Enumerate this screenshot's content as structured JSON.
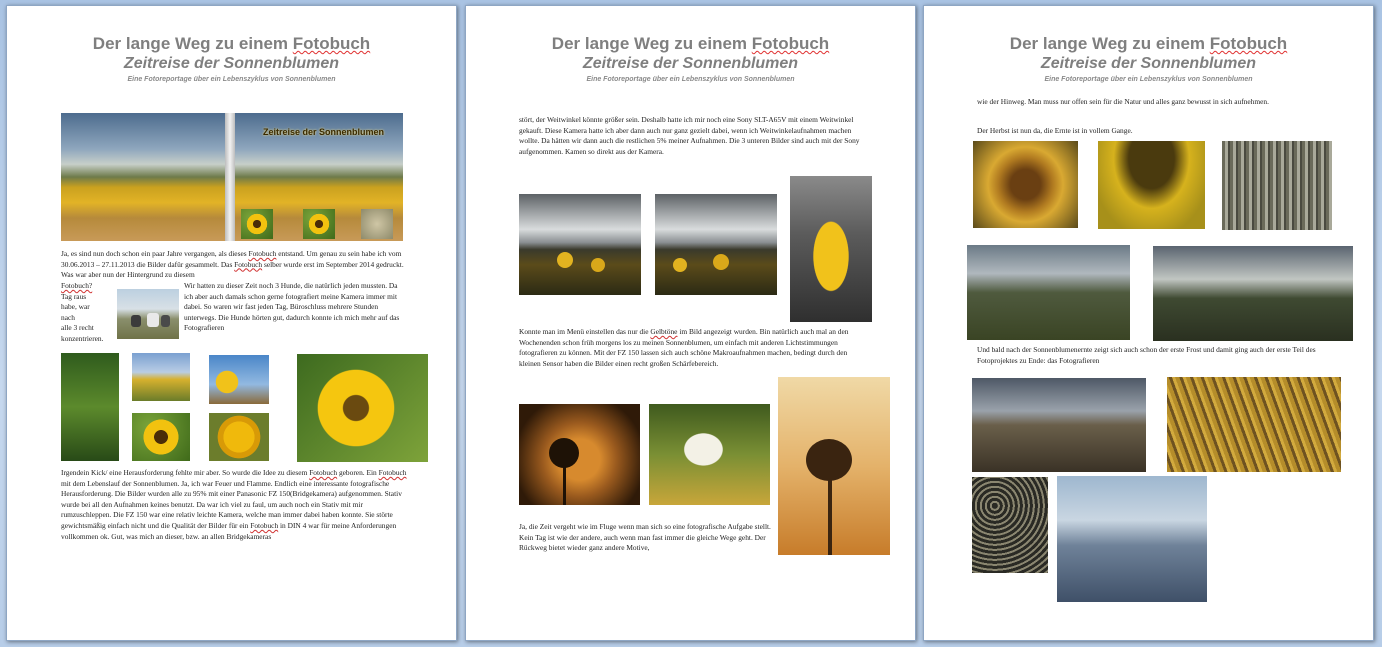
{
  "header": {
    "title_pre": "Der lange Weg zu einem ",
    "title_word": "Fotobuch",
    "subtitle": "Zeitreise der Sonnenblumen",
    "tagline": "Eine Fotoreportage über ein Lebenszyklus von Sonnenblumen"
  },
  "page1": {
    "banner_caption": "Zeitreise der Sonnenblumen",
    "para1": {
      "a": "Ja, es sind nun doch schon ein paar Jahre vergangen, als dieses ",
      "b": "Fotobuch",
      "c": " entstand. Um genau zu sein habe ich vom 30.06.2013 – 27.11.2013 die Bilder dafür gesammelt. Das ",
      "d": "Fotobuch",
      "e": " selber wurde erst im September 2014 gedruckt. Was war aber nun der Hintergrund zu diesem"
    },
    "left_col": {
      "w": "Fotobuch?",
      "l1": "Tag raus",
      "l2": "habe, war",
      "l3": "nach",
      "l4": "alle 3 recht",
      "l5": "konzentrieren."
    },
    "right_col": "Wir hatten zu dieser Zeit noch 3 Hunde, die natürlich jeden mussten. Da ich aber auch damals schon gerne fotografiert meine Kamera immer mit dabei. So waren wir fast jeden Tag, Büroschluss mehrere Stunden unterwegs. Die Hunde hörten gut, dadurch konnte ich mich mehr auf das Fotografieren",
    "para2": {
      "a": "Irgendein Kick/ eine Herausforderung fehlte mir aber. So wurde die Idee zu diesem ",
      "b": "Fotobuch",
      "c": " geboren. Ein ",
      "d": "Fotobuch",
      "e": " mit dem Lebenslauf der Sonnenblumen. Ja, ich war Feuer und Flamme. Endlich eine interessante fotografische Herausforderung. Die Bilder wurden alle zu 95% mit einer Panasonic FZ 150(Bridgekamera) aufgenommen. Stativ wurde bei all den Aufnahmen keines benutzt. Da war ich viel zu faul, um auch noch ein Stativ mit mir rumzuschleppen. Die FZ 150 war eine relativ leichte Kamera, welche man immer dabei haben konnte. Sie störte gewichtsmäßig einfach nicht und die Qualität der Bilder für ein ",
      "f": "Fotobuch",
      "g": " in DIN 4 war für meine Anforderungen vollkommen ok. Gut, was mich an dieser, bzw. an allen Bridgekameras"
    }
  },
  "page2": {
    "para1": "stört, der Weitwinkel könnte größer sein. Deshalb hatte ich mir noch eine Sony SLT-A65V mit einem Weitwinkel gekauft. Diese Kamera hatte ich aber dann auch nur ganz gezielt dabei, wenn ich Weitwinkelaufnahmen machen wollte. Da hätten wir dann auch die restlichen 5% meiner Aufnahmen. Die 3 unteren Bilder sind auch mit der Sony aufgenommen. Kamen so direkt aus der Kamera.",
    "para2": {
      "a": "Konnte man im Menü einstellen das nur die ",
      "b": "Gelbtöne",
      "c": " im Bild angezeigt wurden. Bin natürlich auch mal an den Wochenenden schon früh morgens los zu meinen Sonnenblumen, um einfach mit anderen Lichtstimmungen fotografieren zu können. Mit der FZ 150 lassen sich auch schöne Makroaufnahmen machen, bedingt durch den kleinen Sensor haben die Bilder einen recht großen Schärfebereich."
    },
    "para3": "Ja, die Zeit vergeht wie im Fluge wenn   man sich so eine fotografische Aufgabe stellt. Kein Tag ist wie der andere, auch wenn man fast immer die gleiche Wege geht. Der Rückweg bietet wieder ganz andere Motive,"
  },
  "page3": {
    "para1": "wie der Hinweg. Man muss nur offen sein für die Natur und alles ganz bewusst in sich aufnehmen.",
    "para2": "Der Herbst ist nun da, die Ernte ist in vollem Gange.",
    "para3": "Und bald nach der Sonnenblumenernte zeigt sich auch schon der erste Frost und damit ging auch der erste Teil des Fotoprojektes  zu Ende: das Fotografieren"
  }
}
